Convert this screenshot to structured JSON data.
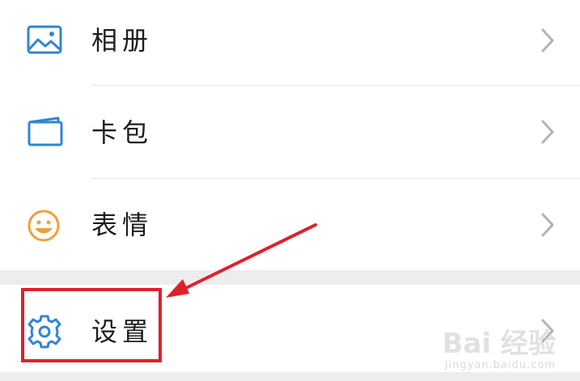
{
  "menu": {
    "items": [
      {
        "label": "相册",
        "icon": "album-icon",
        "icon_color": "#2f86d6"
      },
      {
        "label": "卡包",
        "icon": "card-wallet-icon",
        "icon_color": "#2f86d6"
      },
      {
        "label": "表情",
        "icon": "emoji-icon",
        "icon_color": "#f0a03c"
      },
      {
        "label": "设置",
        "icon": "gear-icon",
        "icon_color": "#2f86d6"
      }
    ]
  },
  "annotation": {
    "highlight_color": "#e0202a",
    "highlighted_item": "设置"
  },
  "watermark": {
    "brand": "Bai 经验",
    "url": "jingyan.baidu.com"
  }
}
